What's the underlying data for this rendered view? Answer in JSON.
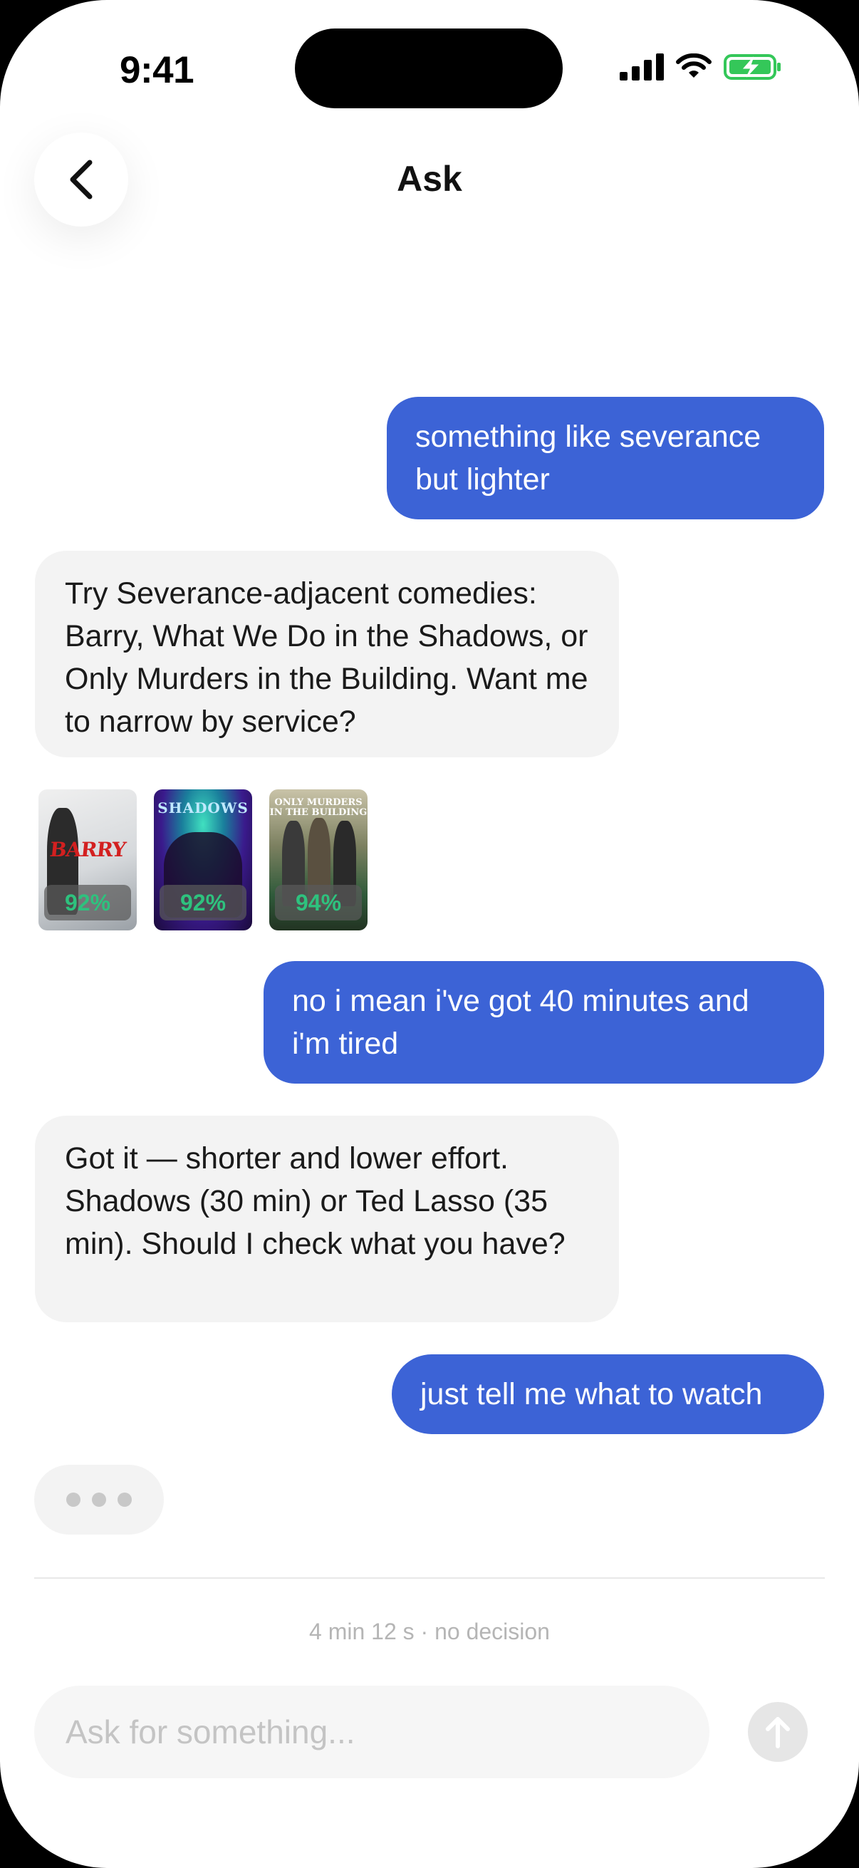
{
  "status_bar": {
    "time": "9:41"
  },
  "nav": {
    "title": "Ask"
  },
  "messages": [
    {
      "role": "user",
      "text": "something like severance but lighter"
    },
    {
      "role": "assistant",
      "text": "Try Severance-adjacent comedies: Barry, What We Do in the Shadows, or Only Murders in the Building. Want me to narrow by service?"
    },
    {
      "role": "user",
      "text": "no i mean i've got 40 minutes and i'm tired"
    },
    {
      "role": "assistant",
      "text": "Got it — shorter and lower effort. Shadows (30 min) or Ted Lasso (35 min). Should I check what you have?"
    },
    {
      "role": "user",
      "text": "just tell me what to watch"
    }
  ],
  "posters": [
    {
      "title": "BARRY",
      "score": "92%"
    },
    {
      "title": "SHADOWS",
      "score": "92%"
    },
    {
      "title": "ONLY MURDERS IN THE BUILDING",
      "score": "94%"
    }
  ],
  "session_meta": "4 min 12 s · no decision",
  "composer": {
    "placeholder": "Ask for something..."
  },
  "colors": {
    "user_bubble": "#3C63D6",
    "bot_bubble": "#F3F3F3",
    "score_text": "#2EC27E"
  }
}
